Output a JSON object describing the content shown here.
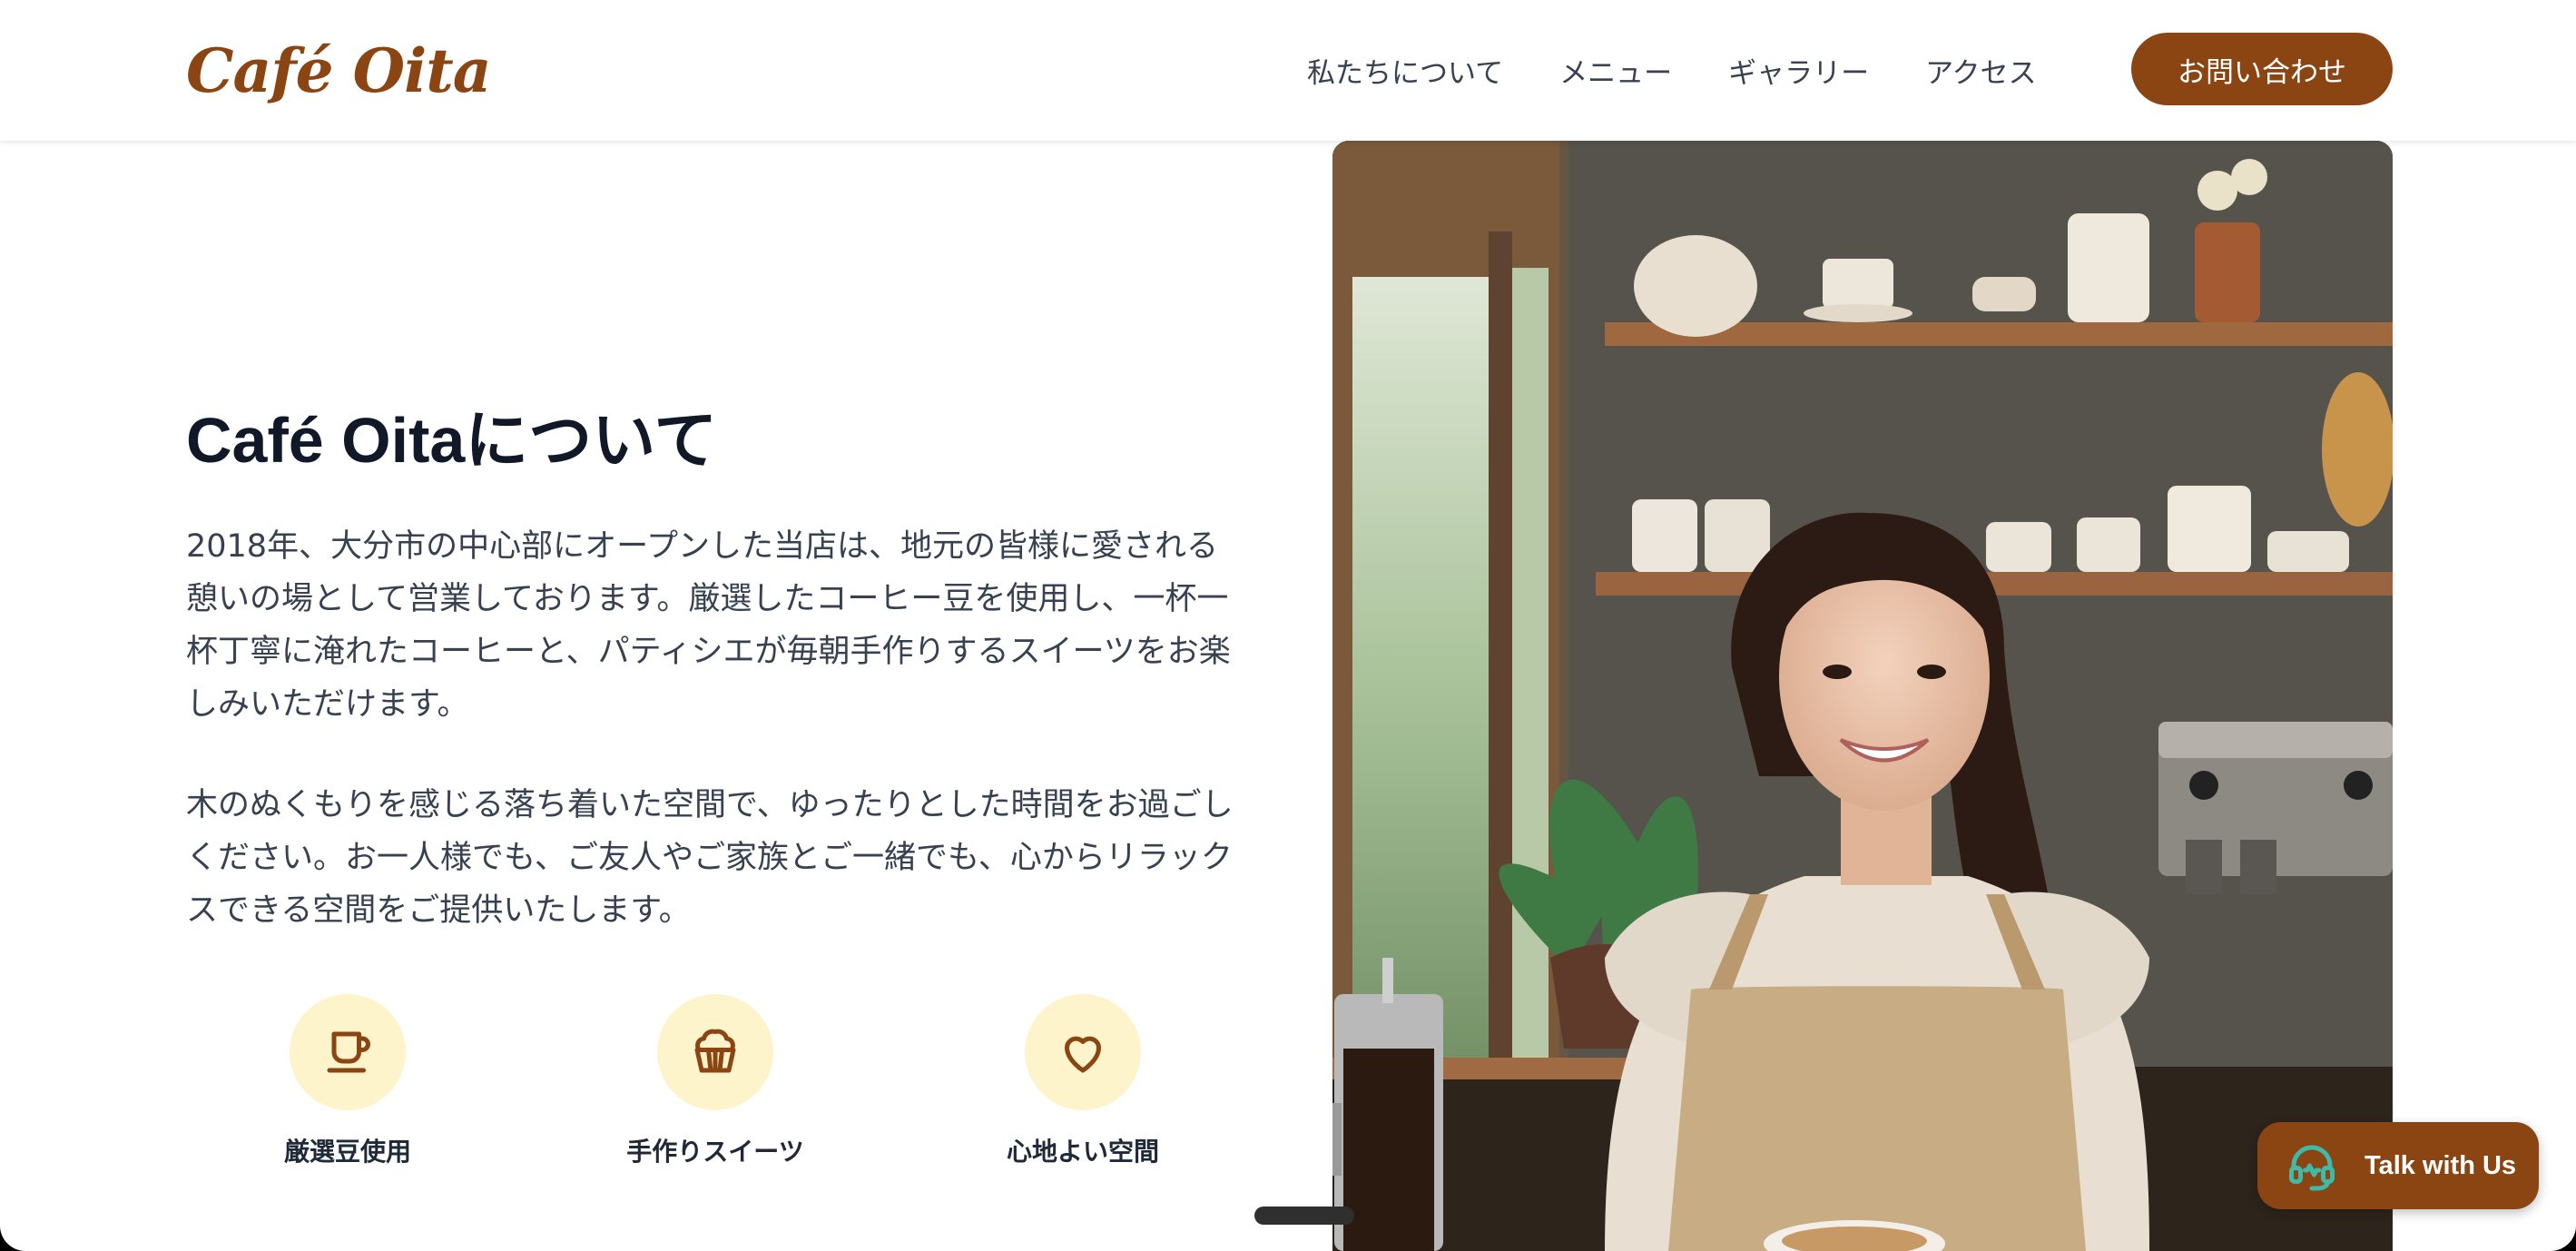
{
  "brand": {
    "logo": "Café Oita",
    "accent_color": "#8b4513"
  },
  "nav": {
    "items": [
      {
        "label": "私たちについて"
      },
      {
        "label": "メニュー"
      },
      {
        "label": "ギャラリー"
      },
      {
        "label": "アクセス"
      }
    ],
    "contact_button": "お問い合わせ"
  },
  "about": {
    "title": "Café Oitaについて",
    "paragraphs": [
      "2018年、大分市の中心部にオープンした当店は、地元の皆様に愛される憩いの場として営業しております。厳選したコーヒー豆を使用し、一杯一杯丁寧に淹れたコーヒーと、パティシエが毎朝手作りするスイーツをお楽しみいただけます。",
      "木のぬくもりを感じる落ち着いた空間で、ゆったりとした時間をお過ごしください。お一人様でも、ご友人やご家族とご一緒でも、心からリラックスできる空間をご提供いたします。"
    ],
    "features": [
      {
        "icon": "coffee-cup-icon",
        "label": "厳選豆使用"
      },
      {
        "icon": "cupcake-icon",
        "label": "手作りスイーツ"
      },
      {
        "icon": "heart-icon",
        "label": "心地よい空間"
      }
    ]
  },
  "photo": {
    "subject": "barista-photo"
  },
  "chat_widget": {
    "label": "Talk with Us",
    "icon": "headset-icon"
  }
}
